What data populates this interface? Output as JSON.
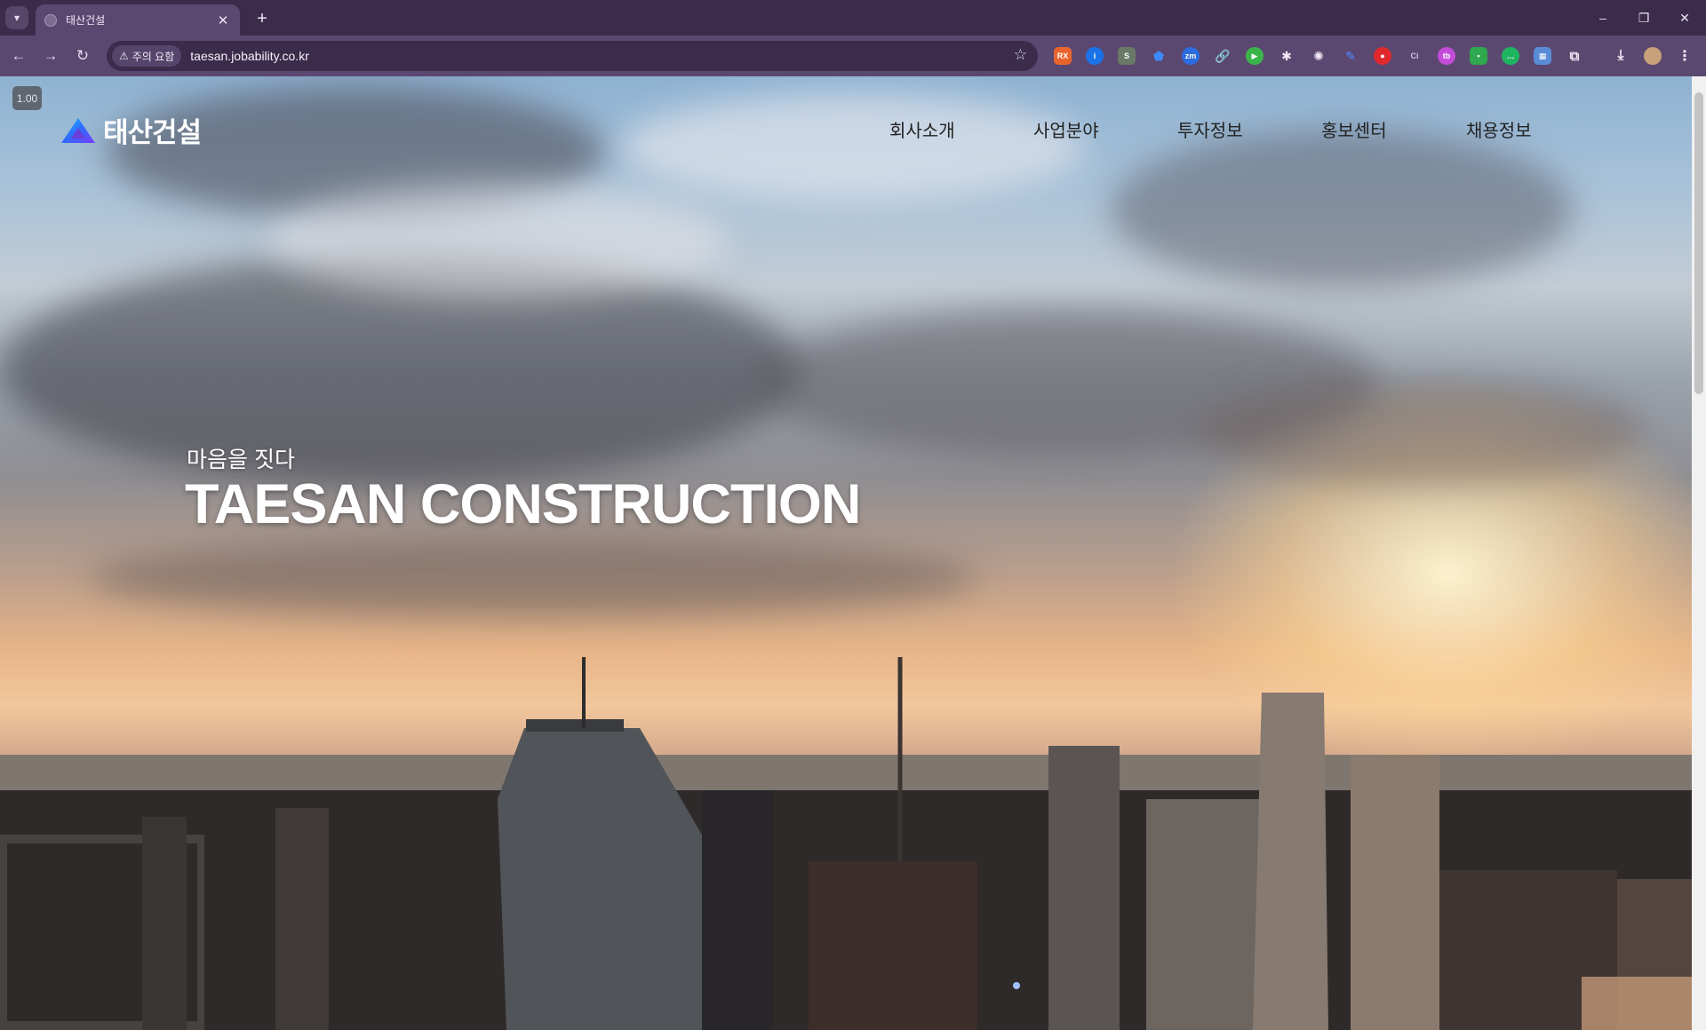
{
  "browser": {
    "tab": {
      "title": "태산건설",
      "close_icon": "close-icon"
    },
    "new_tab_label": "+",
    "window_controls": {
      "minimize": "–",
      "restore": "❐",
      "close": "✕"
    },
    "nav": {
      "back": "←",
      "forward": "→",
      "reload": "↻"
    },
    "security_chip": {
      "icon": "warning-icon",
      "label": "주의 요함"
    },
    "url": "taesan.jobability.co.kr",
    "bookmark_icon": "star-icon"
  },
  "page": {
    "zoom_badge": "1.00",
    "logo": {
      "text": "태산건설",
      "brand_colors": [
        "#2f6bff",
        "#7a3cff",
        "#19c0ff"
      ]
    },
    "nav_items": [
      "회사소개",
      "사업분야",
      "투자정보",
      "홍보센터",
      "채용정보"
    ],
    "hero": {
      "subtitle": "마음을 짓다",
      "title": "TAESAN CONSTRUCTION"
    }
  }
}
